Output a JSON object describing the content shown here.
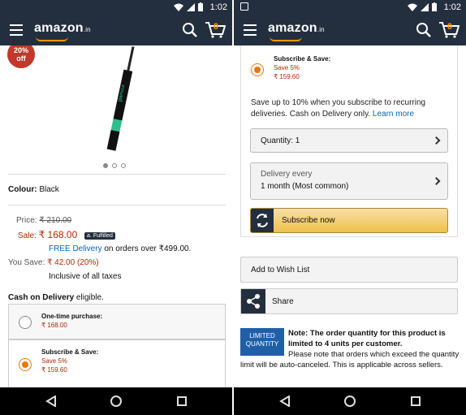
{
  "status": {
    "time": "1:02"
  },
  "appbar": {
    "logo": "amazon",
    "logo_suffix": ".in",
    "cart_count": "0"
  },
  "left": {
    "discount": {
      "pct": "20%",
      "off": "off"
    },
    "colour": {
      "label": "Colour:",
      "value": "Black"
    },
    "price": {
      "label": "Price:",
      "mrp": "₹ 210.00"
    },
    "sale": {
      "label": "Sale:",
      "value": "₹ 168.00",
      "badge": "a. Fulfilled"
    },
    "delivery": {
      "link": "FREE Delivery",
      "rest": " on orders over ₹499.00."
    },
    "save": {
      "label": "You Save:",
      "value": "₹ 42.00 (20%)"
    },
    "taxes": "Inclusive of all taxes",
    "cod": {
      "bold": "Cash on Delivery",
      "rest": " eligible."
    },
    "option1": {
      "title": "One-time purchase:",
      "price": "₹ 168.00"
    },
    "option2": {
      "title": "Subscribe & Save:",
      "save": "Save 5%",
      "price": "₹ 159.60"
    }
  },
  "right": {
    "option": {
      "title": "Subscribe & Save:",
      "save": "Save 5%",
      "price": "₹ 159.60"
    },
    "desc": "Save up to 10% when you subscribe to recurring deliveries. Cash on Delivery only. ",
    "learn_more": "Learn more",
    "quantity": "Quantity: 1",
    "delivery_every": {
      "label": "Delivery every",
      "value": "1 month (Most common)"
    },
    "subscribe_now": "Subscribe now",
    "wish_list": "Add to Wish List",
    "share": "Share",
    "limited": {
      "line1": "LIMITED",
      "line2": "QUANTITY"
    },
    "note": {
      "label": "Note",
      "bold": ": The order quantity for this product is limited to 4 units per customer.",
      "rest": " Please note that orders which exceed the quantity limit will be auto-canceled. This is applicable across sellers."
    }
  }
}
